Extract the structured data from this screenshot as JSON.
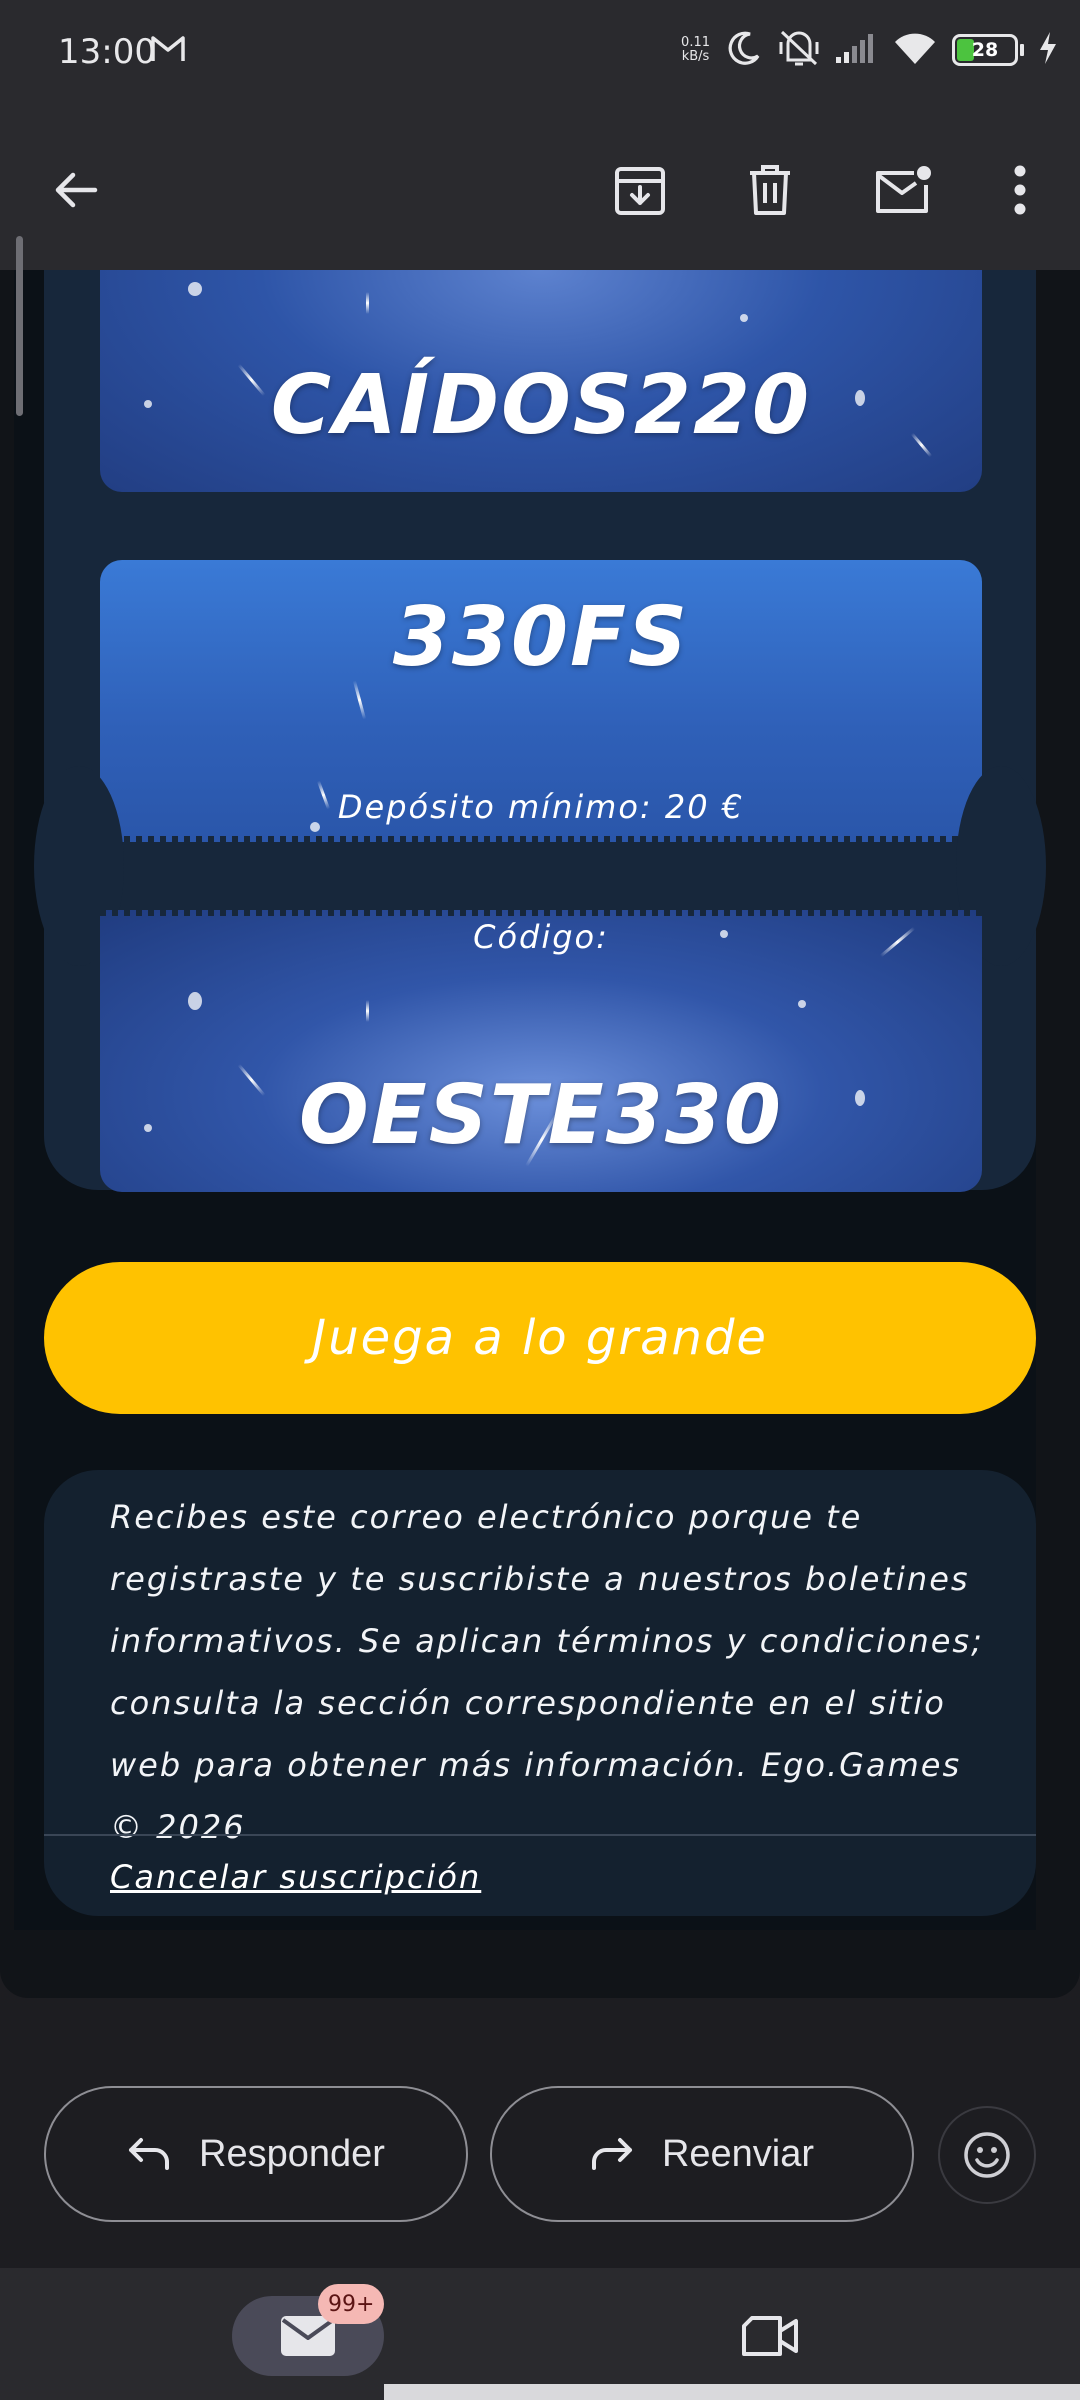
{
  "status_bar": {
    "time": "13:00",
    "net_speed_value": "0.11",
    "net_speed_unit": "kB/s",
    "battery_level": "28",
    "icons": [
      "gmail-icon",
      "moon-icon",
      "vibrate-off-icon",
      "signal-icon",
      "wifi-icon",
      "battery-icon",
      "charging-icon"
    ]
  },
  "app_bar": {
    "icons": [
      "back-arrow-icon",
      "archive-icon",
      "delete-icon",
      "mark-unread-icon",
      "more-vert-icon"
    ]
  },
  "email": {
    "code_one": "CAÍDOS220",
    "spins_offer": "330FS",
    "min_deposit": "Depósito mínimo: 20 €",
    "code_label": "Código:",
    "code_two": "OESTE330",
    "cta_label": "Juega a lo grande",
    "footer_text": "Recibes este correo electrónico porque te registraste y te suscribiste a nuestros boletines informativos. Se aplican términos y condiciones; consulta la sección correspondiente en el sitio web para obtener más información. Ego.Games © 2026",
    "unsubscribe": "Cancelar suscripción"
  },
  "actions": {
    "reply_label": "Responder",
    "forward_label": "Reenviar"
  },
  "bottom_nav": {
    "mail_badge": "99+"
  },
  "colors": {
    "cta": "#ffc200",
    "card": "#17273b",
    "ticket_blue": "#2f60b8"
  }
}
